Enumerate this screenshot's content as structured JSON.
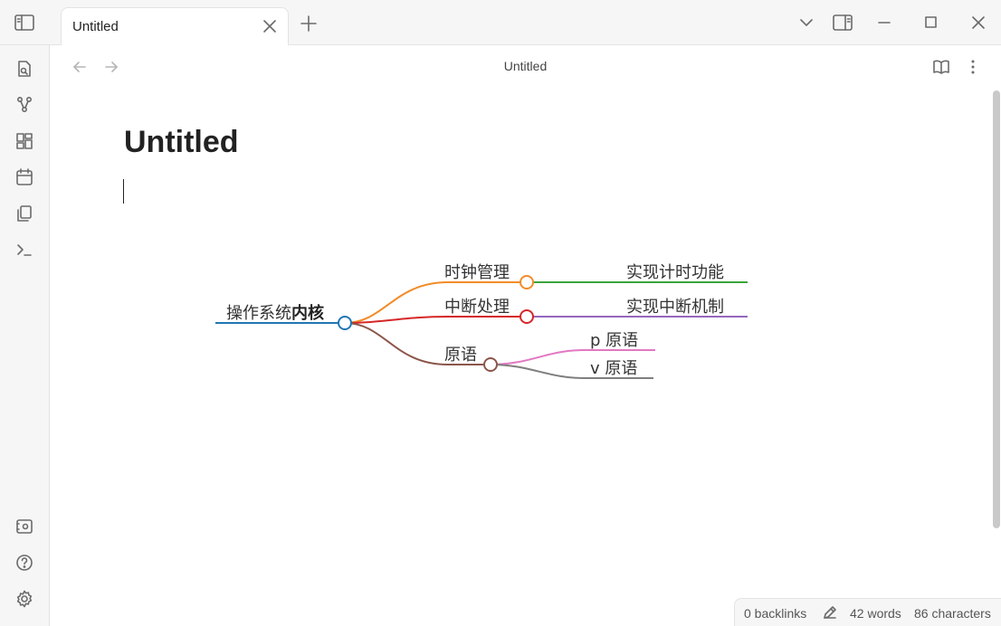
{
  "tab": {
    "title": "Untitled"
  },
  "view": {
    "title": "Untitled"
  },
  "document": {
    "title": "Untitled"
  },
  "mindmap": {
    "root": {
      "prefix": "操作系统",
      "bold": "内核"
    },
    "branches": [
      {
        "label": "时钟管理",
        "child": "实现计时功能",
        "color": "#f28c28",
        "child_color": "#3aa53a"
      },
      {
        "label": "中断处理",
        "child": "实现中断机制",
        "color": "#d62728",
        "child_color": "#9467bd"
      },
      {
        "label": "原语",
        "color": "#8c564b",
        "children": [
          {
            "label": "p 原语",
            "color": "#e377c2"
          },
          {
            "label": "v 原语",
            "color": "#7f7f7f"
          }
        ]
      }
    ],
    "root_color": "#1f77b4"
  },
  "status": {
    "backlinks": "0 backlinks",
    "words": "42 words",
    "characters": "86 characters"
  },
  "icons": {
    "titlebar": [
      "sidebar-toggle-icon",
      "close-icon",
      "plus-icon",
      "chevron-down-icon",
      "right-sidebar-icon",
      "minimize-icon",
      "maximize-icon",
      "window-close-icon"
    ],
    "ribbon": [
      "open-quick-switcher-icon",
      "graph-view-icon",
      "canvas-icon",
      "daily-note-icon",
      "templates-icon",
      "command-palette-icon",
      "vault-icon",
      "help-icon",
      "settings-icon"
    ]
  }
}
